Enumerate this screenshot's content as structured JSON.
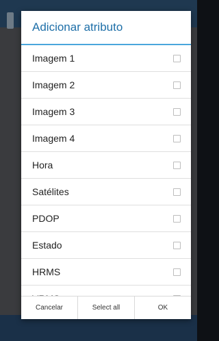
{
  "dialog": {
    "title": "Adicionar atributo",
    "items": [
      {
        "label": "Imagem 1",
        "checked": false
      },
      {
        "label": "Imagem 2",
        "checked": false
      },
      {
        "label": "Imagem 3",
        "checked": false
      },
      {
        "label": "Imagem 4",
        "checked": false
      },
      {
        "label": "Hora",
        "checked": false
      },
      {
        "label": "Satélites",
        "checked": false
      },
      {
        "label": "PDOP",
        "checked": false
      },
      {
        "label": "Estado",
        "checked": false
      },
      {
        "label": "HRMS",
        "checked": false
      },
      {
        "label": "VRMS",
        "checked": false
      }
    ],
    "buttons": {
      "cancel": "Cancelar",
      "select_all": "Select all",
      "ok": "OK"
    }
  },
  "colors": {
    "title": "#1e6fa8",
    "divider": "#4aa6dc",
    "overlay": "#3a3b3e"
  }
}
